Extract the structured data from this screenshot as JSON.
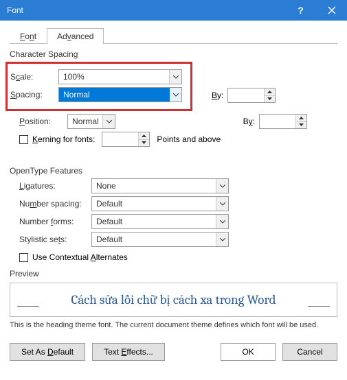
{
  "titlebar": {
    "title": "Font",
    "help": "?",
    "close": "×"
  },
  "tabs": {
    "font": "Font",
    "advanced": "Advanced"
  },
  "charSpacing": {
    "label": "Character Spacing",
    "scaleLabel": "Scale:",
    "scaleValue": "100%",
    "spacingLabel": "Spacing:",
    "spacingValue": "Normal",
    "byLabel1": "By:",
    "byValue1": "",
    "positionLabel": "Position:",
    "positionValue": "Normal",
    "byLabel2": "By:",
    "byValue2": "",
    "kerningLabel": "Kerning for fonts:",
    "kerningValue": "",
    "pointsLabel": "Points and above"
  },
  "openType": {
    "label": "OpenType Features",
    "ligaturesLabel": "Ligatures:",
    "ligaturesValue": "None",
    "numSpacingLabel": "Number spacing:",
    "numSpacingValue": "Default",
    "numFormsLabel": "Number forms:",
    "numFormsValue": "Default",
    "stylisticLabel": "Stylistic sets:",
    "stylisticValue": "Default",
    "contextualLabel": "Use Contextual Alternates"
  },
  "preview": {
    "label": "Preview",
    "text": "Cách sửa lỗi chữ bị cách xa trong Word",
    "desc": "This is the heading theme font. The current document theme defines which font will be used."
  },
  "footer": {
    "setDefault": "Set As Default",
    "textEffects": "Text Effects...",
    "ok": "OK",
    "cancel": "Cancel"
  }
}
